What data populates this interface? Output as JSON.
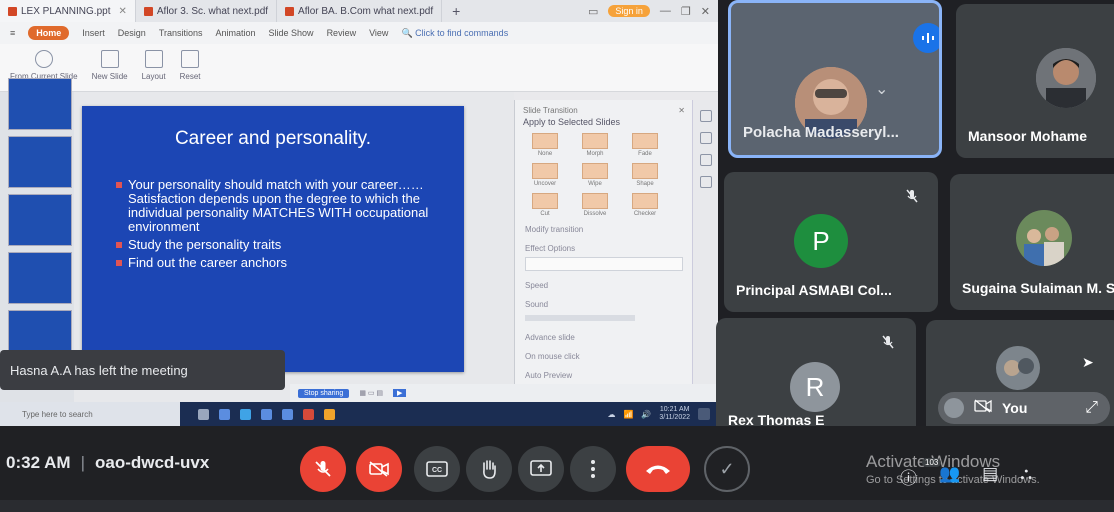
{
  "powerpoint": {
    "tabs": [
      {
        "label": "LEX PLANNING.ppt"
      },
      {
        "label": "Aflor 3. Sc. what next.pdf"
      },
      {
        "label": "Aflor BA. B.Com what next.pdf"
      }
    ],
    "sign_in": "Sign in",
    "ribbon_tabs": [
      "Home",
      "Insert",
      "Design",
      "Transitions",
      "Animation",
      "Slide Show",
      "Review",
      "View"
    ],
    "search_label": "Click to find commands",
    "ribbon_items": [
      "From Current Slide",
      "New Slide",
      "Layout",
      "Reset"
    ],
    "slide": {
      "title": "Career and personality.",
      "bullets": [
        "Your personality should match with your career……Satisfaction depends upon the degree to which the individual personality MATCHES WITH occupational environment",
        "Study the personality traits",
        "Find out the career anchors"
      ]
    },
    "pane": {
      "header": "Slide Transition",
      "subheader": "Apply to Selected Slides",
      "effects": [
        "None",
        "Morph",
        "Fade",
        "Uncover",
        "Wipe",
        "Shape",
        "Cut",
        "Dissolve",
        "Checker"
      ],
      "modify": "Modify transition",
      "effect_options": "Effect Options",
      "speed": "Speed",
      "sound": "Sound",
      "advance": "Advance slide",
      "on_click": "On mouse click",
      "auto": "Auto Preview"
    },
    "status": {
      "sb_btn": "Stop sharing"
    },
    "taskbar": {
      "search": "Type here to search",
      "time": "10:21 AM",
      "date": "3/11/2022"
    }
  },
  "notification": {
    "text": "Hasna A.A has left the meeting"
  },
  "participants": [
    {
      "name": "Polacha Madasseryl...",
      "speaking": true
    },
    {
      "name": "Mansoor Mohame"
    },
    {
      "name": "Principal ASMABI Col...",
      "initial": "P",
      "muted": true,
      "color": "#1e8e3e"
    },
    {
      "name": "Sugaina Sulaiman M. S"
    },
    {
      "name": "Rex Thomas E",
      "initial": "R",
      "muted": true,
      "color": "#8e959c"
    },
    {
      "name": "You"
    }
  ],
  "meeting": {
    "time": "0:32 AM",
    "code": "oao-dwcd-uvx"
  },
  "watermark": {
    "line1": "Activate Windows",
    "line2": "Go to Settings to activate Windows."
  },
  "participant_count": "103",
  "colors": {
    "slide_bg": "#1c46b4",
    "meet_red": "#ea4335",
    "speaker_border": "#8ab4f8",
    "tile_bg": "#3c4043"
  }
}
